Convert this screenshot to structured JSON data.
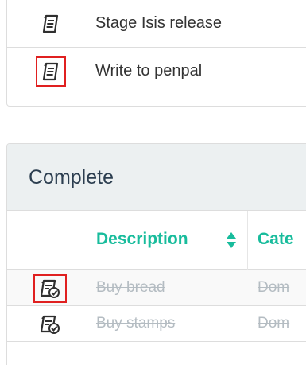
{
  "incomplete": {
    "rows": [
      {
        "description": "Stage Isis release",
        "icon": "todo-list-icon"
      },
      {
        "description": "Write to penpal",
        "icon": "todo-list-icon"
      }
    ]
  },
  "complete": {
    "heading": "Complete",
    "columns": {
      "description": "Description",
      "category": "Cate"
    },
    "rows": [
      {
        "description": "Buy bread",
        "category": "Dom",
        "icon": "todo-done-icon"
      },
      {
        "description": "Buy stamps",
        "category": "Dom",
        "icon": "todo-done-icon"
      }
    ]
  },
  "colors": {
    "accent": "#18bc9c",
    "heading_bg": "#ecf0f1",
    "highlight": "#e02020",
    "muted_text": "#b4bcc2"
  }
}
